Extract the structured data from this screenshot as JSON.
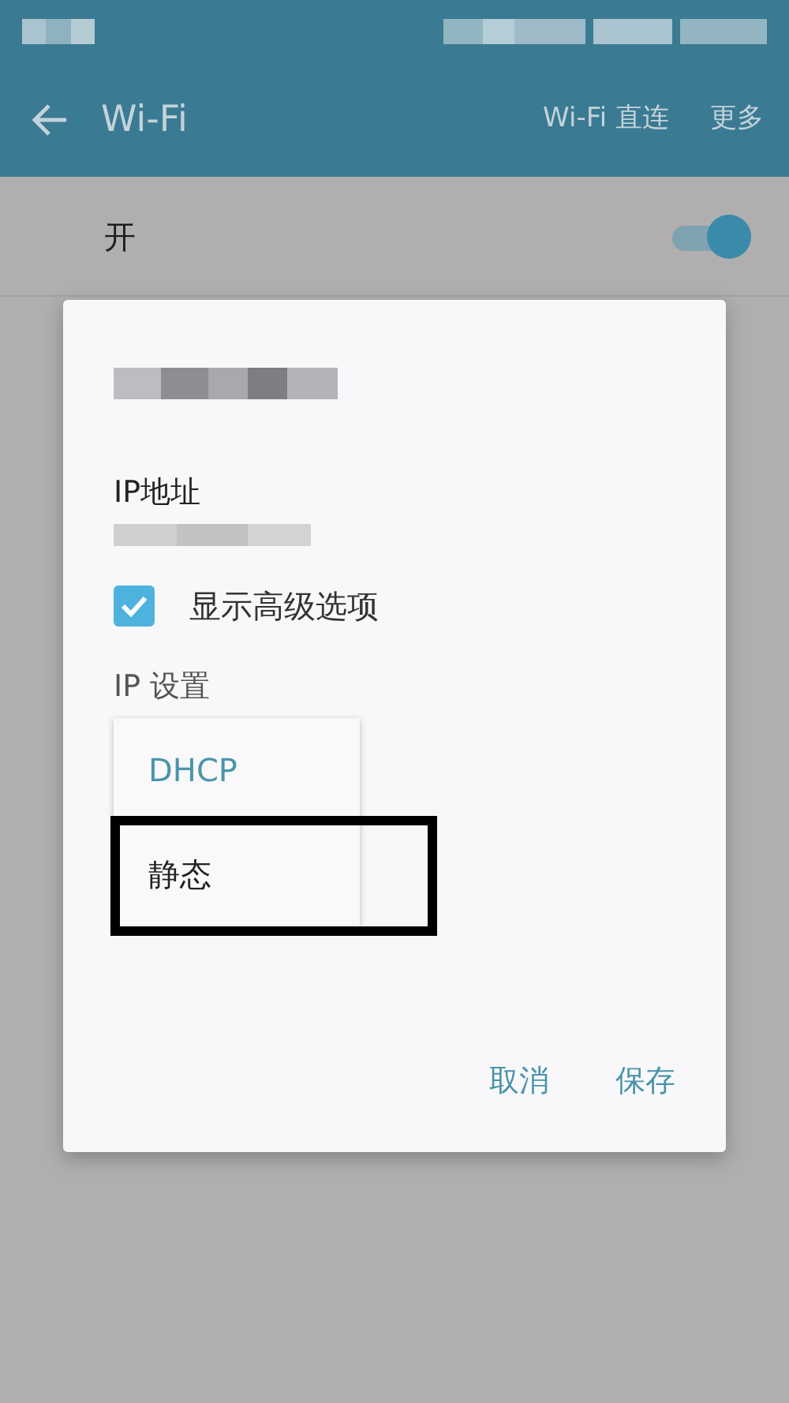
{
  "app_bar": {
    "title": "Wi-Fi",
    "actions": [
      "Wi-Fi 直连",
      "更多"
    ]
  },
  "wifi_switch": {
    "label": "开",
    "on": true
  },
  "dialog": {
    "ip_label": "IP地址",
    "advanced": {
      "label": "显示高级选项",
      "checked": true
    },
    "ip_settings_label": "IP 设置",
    "menu": [
      {
        "label": "DHCP",
        "selected": true
      },
      {
        "label": "静态",
        "selected": false,
        "highlighted": true
      }
    ],
    "buttons": [
      "取消",
      "保存"
    ]
  }
}
